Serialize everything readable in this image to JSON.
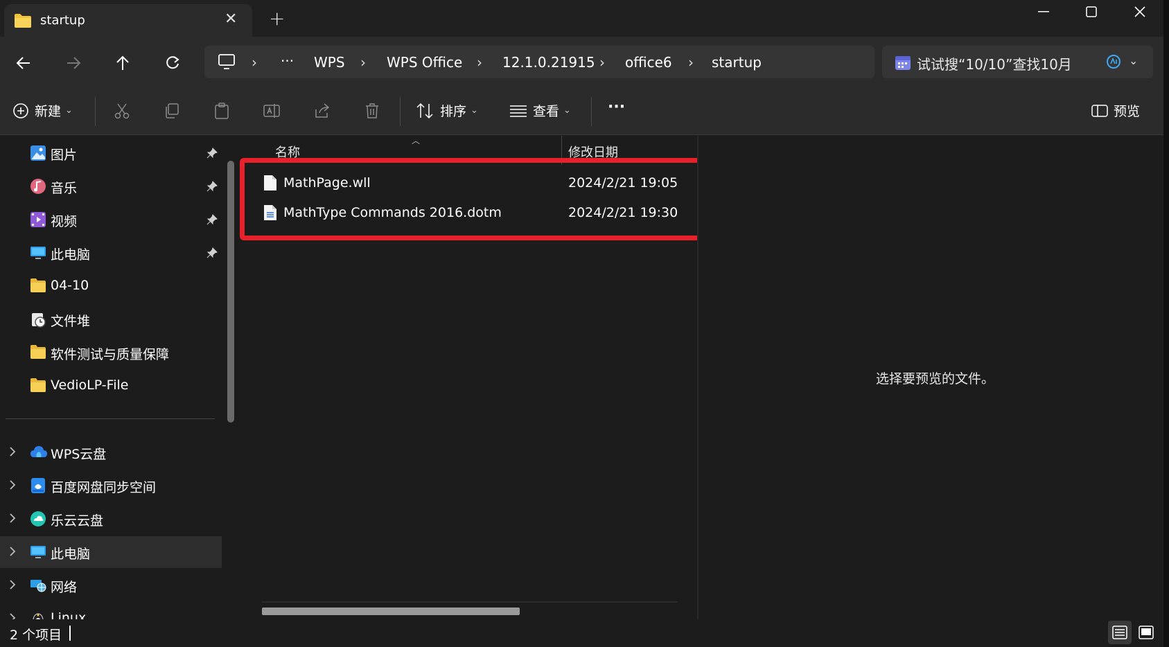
{
  "window": {
    "tab_title": "startup",
    "new_tab": "+"
  },
  "address": {
    "ellipsis": "···",
    "crumbs": [
      "WPS",
      "WPS Office",
      "12.1.0.21915",
      "office6",
      "startup"
    ],
    "search_text": "试试搜“10/10”查找10月"
  },
  "toolbar": {
    "new_label": "新建",
    "sort_label": "排序",
    "view_label": "查看",
    "more_label": "···",
    "preview_label": "预览"
  },
  "sidebar": {
    "quick": [
      {
        "label": "图片",
        "icon": "pictures-icon"
      },
      {
        "label": "音乐",
        "icon": "music-icon"
      },
      {
        "label": "视频",
        "icon": "videos-icon"
      },
      {
        "label": "此电脑",
        "icon": "computer-icon"
      },
      {
        "label": "04-10",
        "icon": "folder-icon"
      },
      {
        "label": "文件堆",
        "icon": "recent-icon"
      },
      {
        "label": "软件测试与质量保障",
        "icon": "folder-icon"
      },
      {
        "label": "VedioLP-File",
        "icon": "folder-icon"
      }
    ],
    "tree": [
      {
        "label": "WPS云盘",
        "icon": "cloud-icon"
      },
      {
        "label": "百度网盘同步空间",
        "icon": "baidu-icon"
      },
      {
        "label": "乐云云盘",
        "icon": "leyun-icon"
      },
      {
        "label": "此电脑",
        "icon": "computer-icon"
      },
      {
        "label": "网络",
        "icon": "network-icon"
      },
      {
        "label": "Linux",
        "icon": "linux-icon"
      }
    ]
  },
  "filelist": {
    "col_name": "名称",
    "col_date": "修改日期",
    "rows": [
      {
        "name": "MathPage.wll",
        "date": "2024/2/21 19:05"
      },
      {
        "name": "MathType Commands 2016.dotm",
        "date": "2024/2/21 19:30"
      }
    ]
  },
  "preview": {
    "message": "选择要预览的文件。"
  },
  "status": {
    "count": "2 个项目"
  },
  "colors": {
    "highlight": "#e8212b",
    "background": "#1c1c1c",
    "chrome": "#2b2b2b"
  }
}
